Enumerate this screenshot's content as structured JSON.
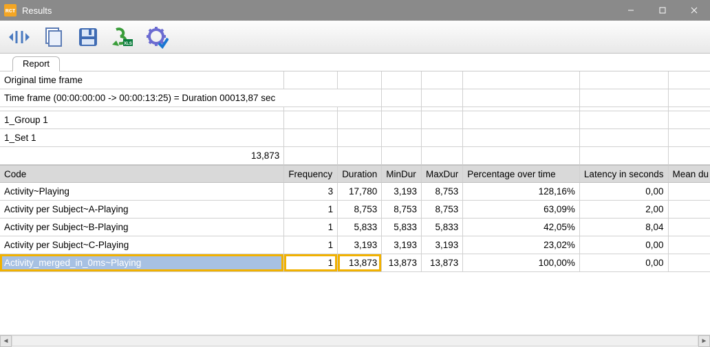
{
  "window": {
    "title": "Results"
  },
  "toolbar": {
    "items": [
      {
        "name": "autofit-columns"
      },
      {
        "name": "copy"
      },
      {
        "name": "save"
      },
      {
        "name": "export-excel"
      },
      {
        "name": "settings"
      }
    ]
  },
  "tab": {
    "label": "Report"
  },
  "info": {
    "original_time_frame": "Original time frame",
    "time_frame_line": "Time frame  (00:00:00:00 -> 00:00:13:25) = Duration 00013,87 sec",
    "group": "1_Group 1",
    "set": "1_Set 1",
    "set_value": "13,873"
  },
  "columns": {
    "code": "Code",
    "frequency": "Frequency",
    "duration": "Duration",
    "mindur": "MinDur",
    "maxdur": "MaxDur",
    "percentage": "Percentage over time",
    "latency": "Latency in seconds",
    "meandur": "Mean du"
  },
  "rows": [
    {
      "code": "Activity~Playing",
      "frequency": "3",
      "duration": "17,780",
      "mindur": "3,193",
      "maxdur": "8,753",
      "percentage": "128,16%",
      "latency": "0,00"
    },
    {
      "code": "Activity per Subject~A-Playing",
      "frequency": "1",
      "duration": "8,753",
      "mindur": "8,753",
      "maxdur": "8,753",
      "percentage": "63,09%",
      "latency": "2,00"
    },
    {
      "code": "Activity per Subject~B-Playing",
      "frequency": "1",
      "duration": "5,833",
      "mindur": "5,833",
      "maxdur": "5,833",
      "percentage": "42,05%",
      "latency": "8,04"
    },
    {
      "code": "Activity per Subject~C-Playing",
      "frequency": "1",
      "duration": "3,193",
      "mindur": "3,193",
      "maxdur": "3,193",
      "percentage": "23,02%",
      "latency": "0,00"
    },
    {
      "code": "Activity_merged_in_0ms~Playing",
      "frequency": "1",
      "duration": "13,873",
      "mindur": "13,873",
      "maxdur": "13,873",
      "percentage": "100,00%",
      "latency": "0,00",
      "selected": true
    }
  ]
}
